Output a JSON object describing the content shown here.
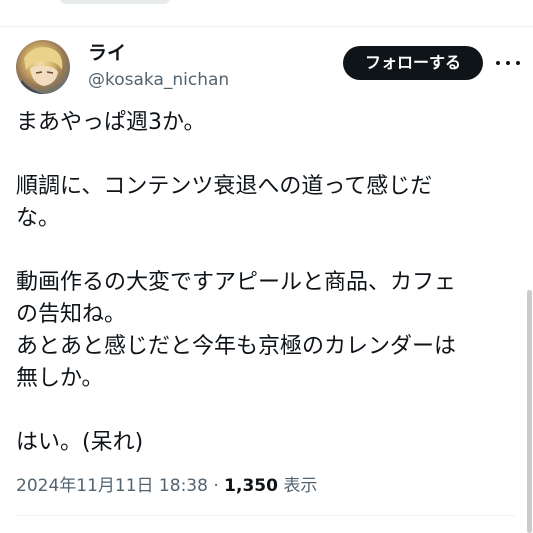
{
  "tweet": {
    "display_name": "ライ",
    "handle": "@kosaka_nichan",
    "follow_label": "フォローする",
    "text_lines": [
      "まあやっぱ週3か。",
      "",
      "順調に、コンテンツ衰退への道って感じだ",
      "な。",
      "",
      "動画作るの大変ですアピールと商品、カフェ",
      "の告知ね。",
      "あとあと感じだと今年も京極のカレンダーは",
      "無しか。",
      "",
      "はい。(呆れ)"
    ],
    "timestamp": "2024年11月11日 18:38",
    "separator": " · ",
    "view_count": "1,350",
    "view_label": "表示"
  },
  "icons": {
    "avatar": "user-avatar",
    "more": "more-options-icon"
  },
  "colors": {
    "text": "#0f1419",
    "secondary": "#536471",
    "button_bg": "#0f1419",
    "button_text": "#ffffff",
    "background": "#ffffff"
  }
}
